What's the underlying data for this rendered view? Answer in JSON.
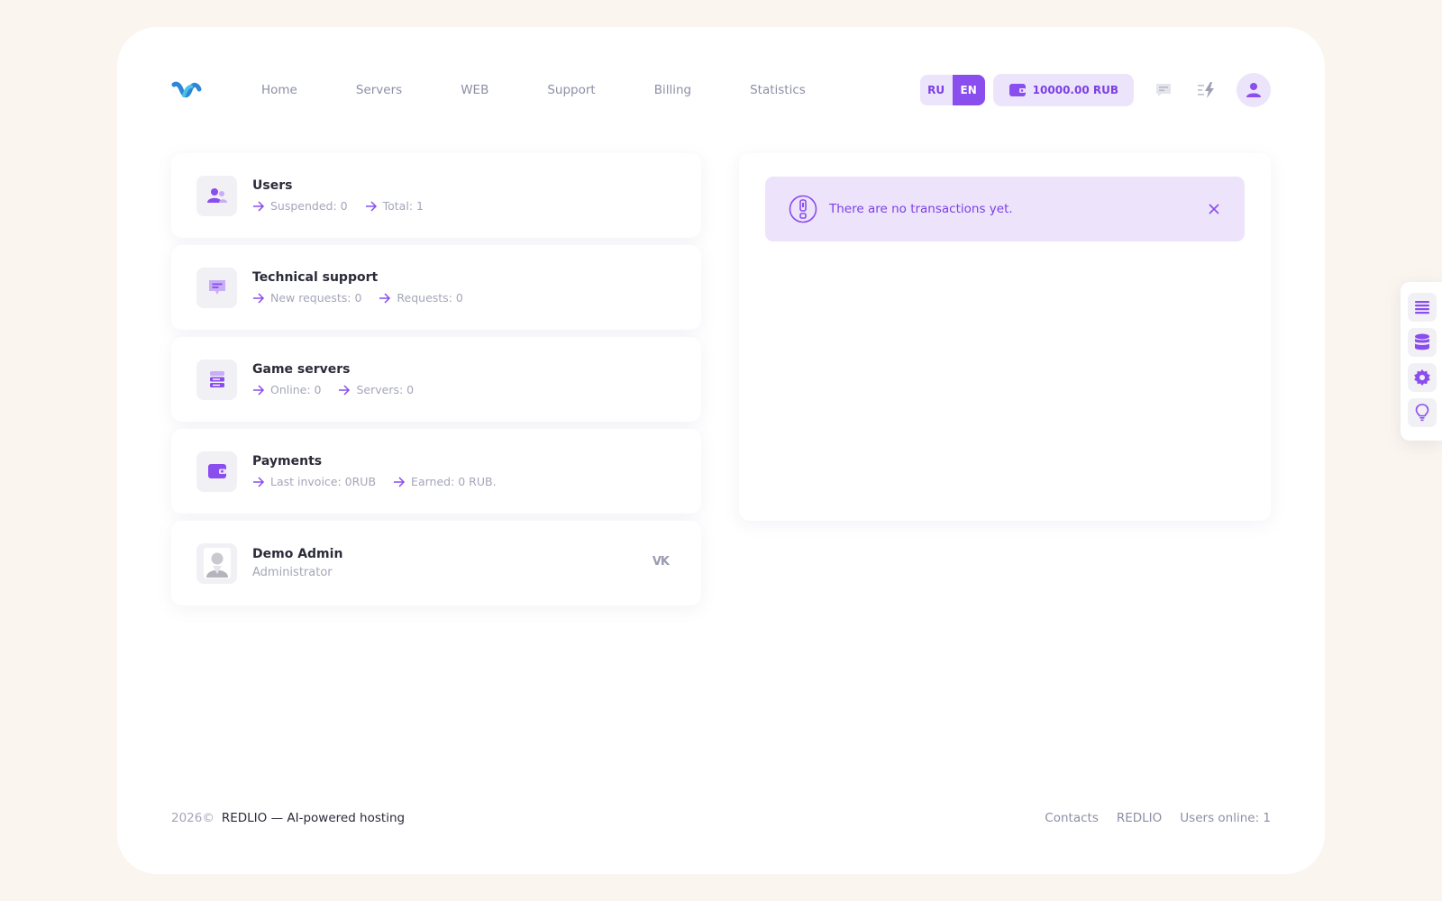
{
  "header": {
    "nav": [
      "Home",
      "Servers",
      "WEB",
      "Support",
      "Billing",
      "Statistics"
    ],
    "lang": {
      "ru": "RU",
      "en": "EN",
      "active": "EN"
    },
    "balance": "10000.00 RUB"
  },
  "cards": {
    "users": {
      "title": "Users",
      "stats": [
        "Suspended: 0",
        "Total: 1"
      ]
    },
    "support": {
      "title": "Technical support",
      "stats": [
        "New requests: 0",
        "Requests: 0"
      ]
    },
    "game_servers": {
      "title": "Game servers",
      "stats": [
        "Online: 0",
        "Servers: 0"
      ]
    },
    "payments": {
      "title": "Payments",
      "stats": [
        "Last invoice: 0RUB",
        "Earned: 0 RUB."
      ]
    }
  },
  "profile": {
    "name": "Demo Admin",
    "role": "Administrator",
    "social": "VK"
  },
  "transactions": {
    "alert": "There are no transactions yet."
  },
  "footer": {
    "year": "2026©",
    "brand": "REDLIO — AI-powered hosting",
    "links": [
      "Contacts",
      "REDLIO"
    ],
    "online": "Users online: 1"
  },
  "colors": {
    "accent": "#8a4dee",
    "accent_soft": "#ece4fb",
    "page_bg": "#faf5ef"
  },
  "icons": {
    "dock": [
      "list-icon",
      "database-icon",
      "gear-icon",
      "lightbulb-icon"
    ]
  }
}
